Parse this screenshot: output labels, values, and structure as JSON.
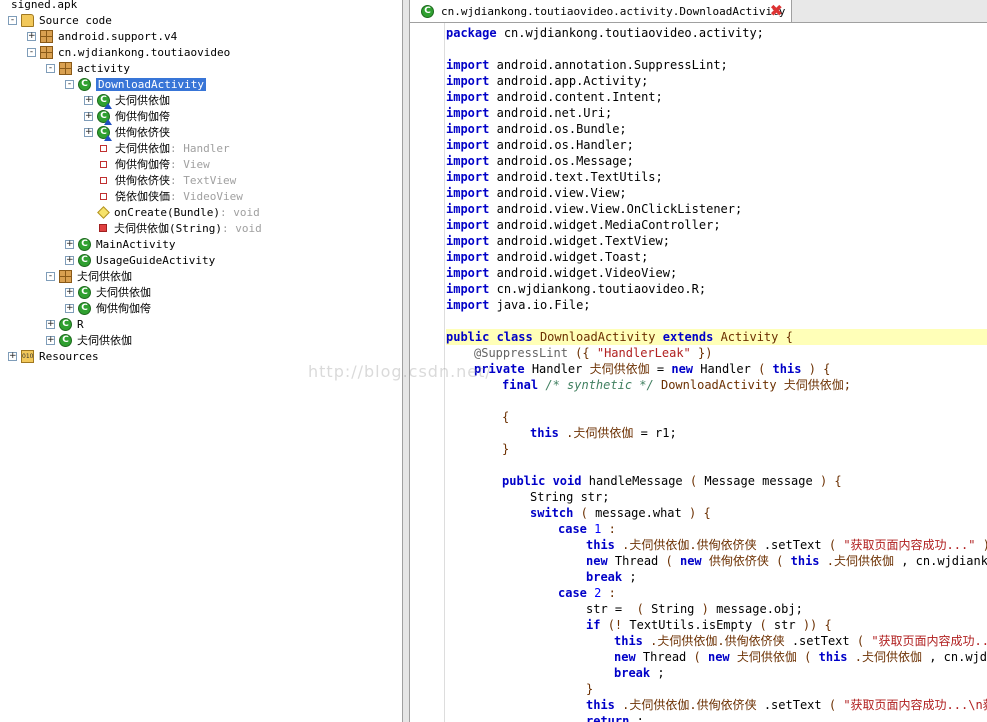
{
  "tree": {
    "items": [
      {
        "text": "signed.apk",
        "icon": "apk-file-icon",
        "level": 0,
        "toggle": ""
      },
      {
        "text": "Source code",
        "icon": "source-folder-icon",
        "level": 0,
        "toggle": "-"
      },
      {
        "text": "android.support.v4",
        "icon": "package-icon",
        "level": 1,
        "toggle": "+"
      },
      {
        "text": "cn.wjdiankong.toutiaovideo",
        "icon": "package-icon",
        "level": 1,
        "toggle": "-"
      },
      {
        "text": "activity",
        "icon": "package-icon",
        "level": 2,
        "toggle": "-"
      },
      {
        "text": "DownloadActivity",
        "icon": "class-icon",
        "level": 3,
        "toggle": "-",
        "selected": true
      },
      {
        "text": "仧伺供依伽",
        "icon": "inner-class-icon",
        "level": 4,
        "toggle": "+"
      },
      {
        "text": "侚供侚伽侉",
        "icon": "inner-class-icon",
        "level": 4,
        "toggle": "+"
      },
      {
        "text": "供侚依侪侠",
        "icon": "inner-class-icon",
        "level": 4,
        "toggle": "+"
      },
      {
        "text": "仧伺供依伽",
        "type": " : Handler",
        "icon": "field-icon",
        "level": 4,
        "toggle": ""
      },
      {
        "text": "侚供侚伽侉",
        "type": " : View",
        "icon": "field-icon",
        "level": 4,
        "toggle": ""
      },
      {
        "text": "供侚依侪侠",
        "type": " : TextView",
        "icon": "field-icon",
        "level": 4,
        "toggle": ""
      },
      {
        "text": "侥依伽侠価",
        "type": " : VideoView",
        "icon": "field-icon",
        "level": 4,
        "toggle": ""
      },
      {
        "text": "onCreate(Bundle)",
        "type": " : void",
        "icon": "method-icon",
        "level": 4,
        "toggle": ""
      },
      {
        "text": "仧伺供依伽(String)",
        "type": " : void",
        "icon": "private-method-icon",
        "level": 4,
        "toggle": ""
      },
      {
        "text": "MainActivity",
        "icon": "class-icon",
        "level": 3,
        "toggle": "+"
      },
      {
        "text": "UsageGuideActivity",
        "icon": "class-icon",
        "level": 3,
        "toggle": "+"
      },
      {
        "text": "仧伺供依伽",
        "icon": "package-icon",
        "level": 2,
        "toggle": "-"
      },
      {
        "text": "仧伺供依伽",
        "icon": "class-icon",
        "level": 3,
        "toggle": "+"
      },
      {
        "text": "侚供侚伽侉",
        "icon": "class-icon",
        "level": 3,
        "toggle": "+"
      },
      {
        "text": "R",
        "icon": "class-icon",
        "level": 2,
        "toggle": "+"
      },
      {
        "text": "仧伺供依伽",
        "icon": "class-icon",
        "level": 2,
        "toggle": "+"
      },
      {
        "text": "Resources",
        "icon": "resources-folder-icon",
        "level": 0,
        "toggle": "+"
      }
    ]
  },
  "editor": {
    "tab_title": "cn.wjdiankong.toutiaovideo.activity.DownloadActivity",
    "close_glyph": "✖",
    "lines": [
      [
        [
          "kw",
          "package"
        ],
        [
          "",
          "cn.wjdiankong.toutiaovideo.activity;"
        ]
      ],
      [],
      [
        [
          "kw",
          "import"
        ],
        [
          "",
          "android.annotation.SuppressLint;"
        ]
      ],
      [
        [
          "kw",
          "import"
        ],
        [
          "",
          "android.app.Activity;"
        ]
      ],
      [
        [
          "kw",
          "import"
        ],
        [
          "",
          "android.content.Intent;"
        ]
      ],
      [
        [
          "kw",
          "import"
        ],
        [
          "",
          "android.net.Uri;"
        ]
      ],
      [
        [
          "kw",
          "import"
        ],
        [
          "",
          "android.os.Bundle;"
        ]
      ],
      [
        [
          "kw",
          "import"
        ],
        [
          "",
          "android.os.Handler;"
        ]
      ],
      [
        [
          "kw",
          "import"
        ],
        [
          "",
          "android.os.Message;"
        ]
      ],
      [
        [
          "kw",
          "import"
        ],
        [
          "",
          "android.text.TextUtils;"
        ]
      ],
      [
        [
          "kw",
          "import"
        ],
        [
          "",
          "android.view.View;"
        ]
      ],
      [
        [
          "kw",
          "import"
        ],
        [
          "",
          "android.view.View.OnClickListener;"
        ]
      ],
      [
        [
          "kw",
          "import"
        ],
        [
          "",
          "android.widget.MediaController;"
        ]
      ],
      [
        [
          "kw",
          "import"
        ],
        [
          "",
          "android.widget.TextView;"
        ]
      ],
      [
        [
          "kw",
          "import"
        ],
        [
          "",
          "android.widget.Toast;"
        ]
      ],
      [
        [
          "kw",
          "import"
        ],
        [
          "",
          "android.widget.VideoView;"
        ]
      ],
      [
        [
          "kw",
          "import"
        ],
        [
          "",
          "cn.wjdiankong.toutiaovideo.R;"
        ]
      ],
      [
        [
          "kw",
          "import"
        ],
        [
          "",
          "java.io.File;"
        ]
      ],
      [],
      [
        [
          "kw",
          "public class"
        ],
        [
          "cls-n",
          "DownloadActivity"
        ],
        [
          "kw",
          "extends"
        ],
        [
          "cls-n",
          "Activity"
        ],
        [
          "cls-n",
          "{"
        ]
      ],
      [
        [
          "",
          ""
        ],
        [
          "ann",
          "@SuppressLint"
        ],
        [
          "cls-n",
          "({"
        ],
        [
          "str",
          "\"HandlerLeak\""
        ],
        [
          "cls-n",
          "})"
        ]
      ],
      [
        [
          "",
          ""
        ],
        [
          "kw",
          "private"
        ],
        [
          "",
          "Handler"
        ],
        [
          "cls-n",
          "仧伺供依伽"
        ],
        [
          "",
          "="
        ],
        [
          "kw",
          "new"
        ],
        [
          "",
          "Handler"
        ],
        [
          "cls-n",
          "("
        ],
        [
          "kw",
          "this"
        ],
        [
          "cls-n",
          ")"
        ],
        [
          "cls-n",
          "{"
        ]
      ],
      [
        [
          "",
          ""
        ],
        [
          "",
          ""
        ],
        [
          "kw",
          "final"
        ],
        [
          "cmt",
          "/* synthetic */"
        ],
        [
          "cls-n",
          "DownloadActivity"
        ],
        [
          "cls-n",
          "仧伺供依伽;"
        ]
      ],
      [],
      [
        [
          "",
          ""
        ],
        [
          "",
          ""
        ],
        [
          "cls-n",
          "{"
        ]
      ],
      [
        [
          "",
          ""
        ],
        [
          "",
          ""
        ],
        [
          "",
          ""
        ],
        [
          "kw",
          "this"
        ],
        [
          "cls-n",
          ".仧伺供依伽"
        ],
        [
          "",
          "= r1;"
        ]
      ],
      [
        [
          "",
          ""
        ],
        [
          "",
          ""
        ],
        [
          "cls-n",
          "}"
        ]
      ],
      [],
      [
        [
          "",
          ""
        ],
        [
          "",
          ""
        ],
        [
          "kw",
          "public void"
        ],
        [
          "",
          "handleMessage"
        ],
        [
          "cls-n",
          "("
        ],
        [
          "",
          "Message message"
        ],
        [
          "cls-n",
          ")"
        ],
        [
          "cls-n",
          "{"
        ]
      ],
      [
        [
          "",
          ""
        ],
        [
          "",
          ""
        ],
        [
          "",
          ""
        ],
        [
          "",
          "String str;"
        ]
      ],
      [
        [
          "",
          ""
        ],
        [
          "",
          ""
        ],
        [
          "",
          ""
        ],
        [
          "kw",
          "switch"
        ],
        [
          "cls-n",
          "("
        ],
        [
          "",
          "message.what"
        ],
        [
          "cls-n",
          ")"
        ],
        [
          "cls-n",
          "{"
        ]
      ],
      [
        [
          "",
          ""
        ],
        [
          "",
          ""
        ],
        [
          "",
          ""
        ],
        [
          "",
          ""
        ],
        [
          "kw",
          "case"
        ],
        [
          "num",
          "1"
        ],
        [
          "cls-n",
          ":"
        ]
      ],
      [
        [
          "",
          ""
        ],
        [
          "",
          ""
        ],
        [
          "",
          ""
        ],
        [
          "",
          ""
        ],
        [
          "",
          ""
        ],
        [
          "kw",
          "this"
        ],
        [
          "cls-n",
          ".仧伺供依伽.供侚依侪侠"
        ],
        [
          "",
          ".setText"
        ],
        [
          "cls-n",
          "("
        ],
        [
          "str",
          "\"获取页面内容成功...\""
        ],
        [
          "cls-n",
          ");"
        ]
      ],
      [
        [
          "",
          ""
        ],
        [
          "",
          ""
        ],
        [
          "",
          ""
        ],
        [
          "",
          ""
        ],
        [
          "",
          ""
        ],
        [
          "kw",
          "new"
        ],
        [
          "",
          "Thread"
        ],
        [
          "cls-n",
          "("
        ],
        [
          "kw",
          "new"
        ],
        [
          "cls-n",
          "供侚依侪侠"
        ],
        [
          "cls-n",
          "("
        ],
        [
          "kw",
          "this"
        ],
        [
          "cls-n",
          ".仧伺供依伽"
        ],
        [
          "",
          ", cn.wjdiankong.tou"
        ]
      ],
      [
        [
          "",
          ""
        ],
        [
          "",
          ""
        ],
        [
          "",
          ""
        ],
        [
          "",
          ""
        ],
        [
          "",
          ""
        ],
        [
          "kw",
          "break"
        ],
        [
          "",
          ";"
        ]
      ],
      [
        [
          "",
          ""
        ],
        [
          "",
          ""
        ],
        [
          "",
          ""
        ],
        [
          "",
          ""
        ],
        [
          "kw",
          "case"
        ],
        [
          "num",
          "2"
        ],
        [
          "cls-n",
          ":"
        ]
      ],
      [
        [
          "",
          ""
        ],
        [
          "",
          ""
        ],
        [
          "",
          ""
        ],
        [
          "",
          ""
        ],
        [
          "",
          ""
        ],
        [
          "",
          "str = "
        ],
        [
          "cls-n",
          "("
        ],
        [
          "",
          "String"
        ],
        [
          "cls-n",
          ")"
        ],
        [
          "",
          "message.obj;"
        ]
      ],
      [
        [
          "",
          ""
        ],
        [
          "",
          ""
        ],
        [
          "",
          ""
        ],
        [
          "",
          ""
        ],
        [
          "",
          ""
        ],
        [
          "kw",
          "if"
        ],
        [
          "cls-n",
          "(!"
        ],
        [
          "",
          "TextUtils.isEmpty"
        ],
        [
          "cls-n",
          "("
        ],
        [
          "",
          "str"
        ],
        [
          "cls-n",
          "))"
        ],
        [
          "cls-n",
          "{"
        ]
      ],
      [
        [
          "",
          ""
        ],
        [
          "",
          ""
        ],
        [
          "",
          ""
        ],
        [
          "",
          ""
        ],
        [
          "",
          ""
        ],
        [
          "",
          ""
        ],
        [
          "kw",
          "this"
        ],
        [
          "cls-n",
          ".仧伺供依伽.供侚依侪侠"
        ],
        [
          "",
          ".setText"
        ],
        [
          "cls-n",
          "("
        ],
        [
          "str",
          "\"获取页面内容成功...\\"
        ]
      ],
      [
        [
          "",
          ""
        ],
        [
          "",
          ""
        ],
        [
          "",
          ""
        ],
        [
          "",
          ""
        ],
        [
          "",
          ""
        ],
        [
          "",
          ""
        ],
        [
          "kw",
          "new"
        ],
        [
          "",
          "Thread"
        ],
        [
          "cls-n",
          "("
        ],
        [
          "kw",
          "new"
        ],
        [
          "cls-n",
          "仧伺供依伽"
        ],
        [
          "cls-n",
          "("
        ],
        [
          "kw",
          "this"
        ],
        [
          "cls-n",
          ".仧伺供依伽"
        ],
        [
          "",
          ", cn.wjdiankon"
        ]
      ],
      [
        [
          "",
          ""
        ],
        [
          "",
          ""
        ],
        [
          "",
          ""
        ],
        [
          "",
          ""
        ],
        [
          "",
          ""
        ],
        [
          "",
          ""
        ],
        [
          "kw",
          "break"
        ],
        [
          "",
          ";"
        ]
      ],
      [
        [
          "",
          ""
        ],
        [
          "",
          ""
        ],
        [
          "",
          ""
        ],
        [
          "",
          ""
        ],
        [
          "",
          ""
        ],
        [
          "cls-n",
          "}"
        ]
      ],
      [
        [
          "",
          ""
        ],
        [
          "",
          ""
        ],
        [
          "",
          ""
        ],
        [
          "",
          ""
        ],
        [
          "",
          ""
        ],
        [
          "kw",
          "this"
        ],
        [
          "cls-n",
          ".仧伺供依伽.供侚依侪侠"
        ],
        [
          "",
          ".setText"
        ],
        [
          "cls-n",
          "("
        ],
        [
          "str",
          "\"获取页面内容成功...\\n获取"
        ]
      ],
      [
        [
          "",
          ""
        ],
        [
          "",
          ""
        ],
        [
          "",
          ""
        ],
        [
          "",
          ""
        ],
        [
          "",
          ""
        ],
        [
          "kw",
          "return"
        ],
        [
          "",
          ";"
        ]
      ]
    ],
    "highlight_line": 19
  },
  "watermark": "http://blog.csdn.net/"
}
